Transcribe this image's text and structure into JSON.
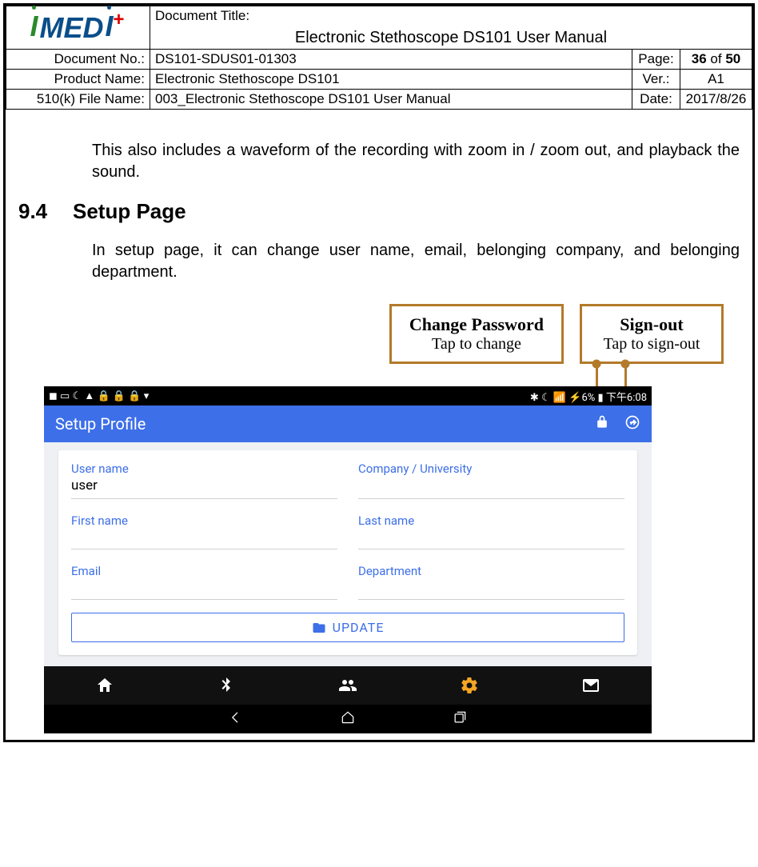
{
  "logo_text": "MEDI",
  "header": {
    "doc_title_label": "Document Title:",
    "doc_title": "Electronic Stethoscope DS101 User Manual",
    "doc_no_label": "Document No.:",
    "doc_no": "DS101-SDUS01-01303",
    "page_label": "Page:",
    "page_current": "36",
    "page_of": " of ",
    "page_total": "50",
    "product_label": "Product Name:",
    "product": "Electronic Stethoscope DS101",
    "ver_label": "Ver.:",
    "ver": "A1",
    "file_label": "510(k) File Name:",
    "file": "003_Electronic Stethoscope DS101 User Manual",
    "date_label": "Date:",
    "date": "2017/8/26"
  },
  "body": {
    "para1": "This also includes a waveform of the recording with zoom in / zoom out, and playback the sound.",
    "sec_num": "9.4",
    "sec_title": "Setup Page",
    "para2": "In setup page, it can change user name, email, belonging company, and belonging department."
  },
  "callouts": {
    "change_pw_title": "Change Password",
    "change_pw_sub": "Tap to change",
    "signout_title": "Sign-out",
    "signout_sub": "Tap to sign-out"
  },
  "screenshot": {
    "status_left_icons": "◼ ▭ ☾ ▲ 🔒 🔒 🔒 ▾",
    "status_right": "✱ ☾ 📶 ⚡6% ▮ 下午6:08",
    "appbar_title": "Setup Profile",
    "fields": {
      "username_label": "User name",
      "username_value": "user",
      "company_label": "Company / University",
      "company_value": "",
      "firstname_label": "First name",
      "firstname_value": "",
      "lastname_label": "Last name",
      "lastname_value": "",
      "email_label": "Email",
      "email_value": "",
      "department_label": "Department",
      "department_value": ""
    },
    "update_label": "UPDATE"
  }
}
